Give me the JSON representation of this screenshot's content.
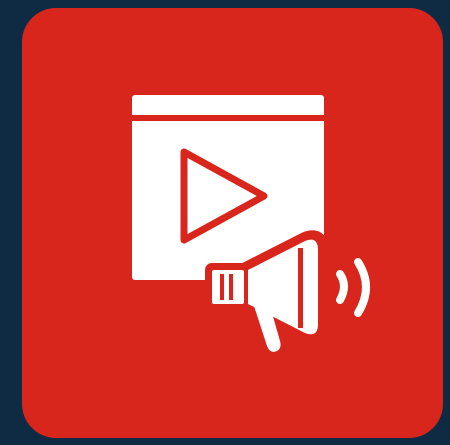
{
  "app": {
    "icon_name": "video-marketing-icon",
    "glyphs": [
      "video-window-icon",
      "play-icon",
      "megaphone-icon",
      "sound-waves-icon"
    ]
  },
  "colors": {
    "page_background": "#0e2b43",
    "tile_background": "#d9261c",
    "glyph": "#ffffff"
  }
}
